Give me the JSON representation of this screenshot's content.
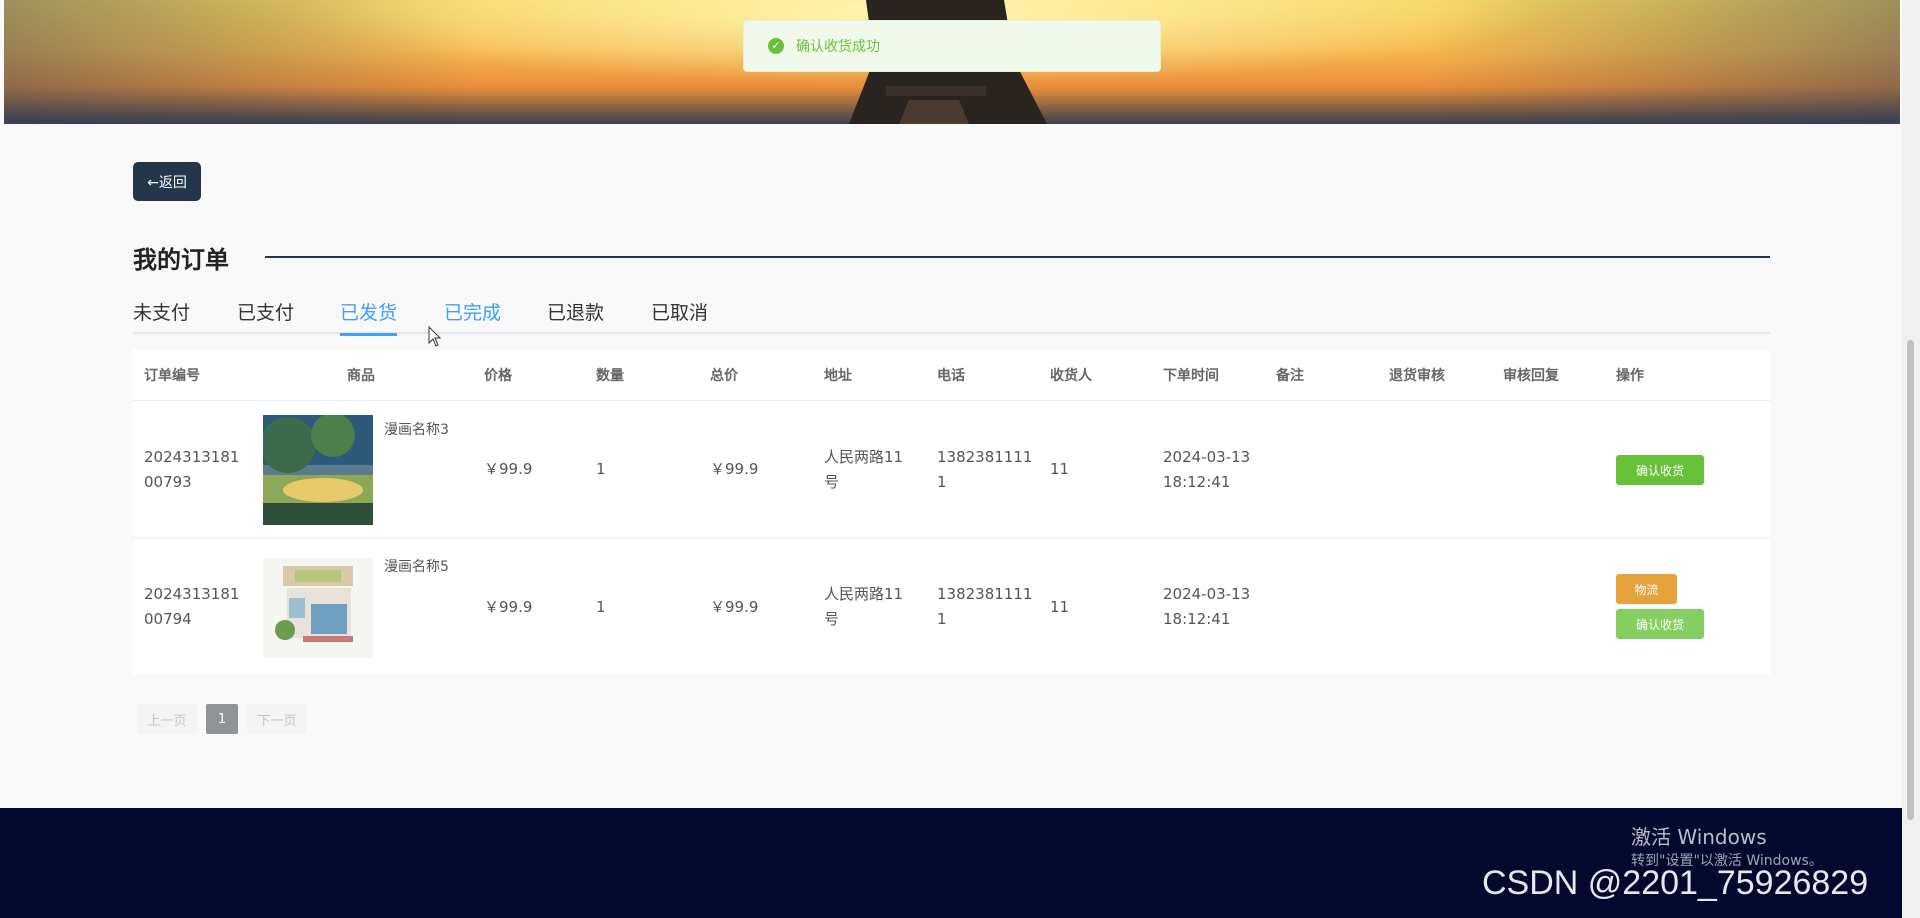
{
  "toast": {
    "icon": "check-circle-icon",
    "message": "确认收货成功"
  },
  "back_button": {
    "label": "←返回"
  },
  "page_title": "我的订单",
  "tabs": [
    {
      "label": "未支付",
      "state": "normal"
    },
    {
      "label": "已支付",
      "state": "normal"
    },
    {
      "label": "已发货",
      "state": "active"
    },
    {
      "label": "已完成",
      "state": "hover"
    },
    {
      "label": "已退款",
      "state": "normal"
    },
    {
      "label": "已取消",
      "state": "normal"
    }
  ],
  "table": {
    "headers": [
      "订单编号",
      "商品",
      "价格",
      "数量",
      "总价",
      "地址",
      "电话",
      "收货人",
      "下单时间",
      "备注",
      "退货审核",
      "审核回复",
      "操作"
    ],
    "rows": [
      {
        "order_no_1": "2024313181",
        "order_no_2": "00793",
        "goods_name": "漫画名称3",
        "price": "￥99.9",
        "qty": "1",
        "total": "￥99.9",
        "address_1": "人民两路11",
        "address_2": "号",
        "phone_1": "1382381111",
        "phone_2": "1",
        "receiver": "11",
        "time_1": "2024-03-13",
        "time_2": "18:12:41",
        "remark": "",
        "return_review": "",
        "review_reply": "",
        "actions": [
          "确认收货"
        ]
      },
      {
        "order_no_1": "2024313181",
        "order_no_2": "00794",
        "goods_name": "漫画名称5",
        "price": "￥99.9",
        "qty": "1",
        "total": "￥99.9",
        "address_1": "人民两路11",
        "address_2": "号",
        "phone_1": "1382381111",
        "phone_2": "1",
        "receiver": "11",
        "time_1": "2024-03-13",
        "time_2": "18:12:41",
        "remark": "",
        "return_review": "",
        "review_reply": "",
        "actions": [
          "物流",
          "确认收货"
        ]
      }
    ]
  },
  "pagination": {
    "prev": "上一页",
    "current": "1",
    "next": "下一页"
  },
  "os_overlay": {
    "activate_title": "激活 Windows",
    "activate_sub": "转到\"设置\"以激活 Windows。"
  },
  "watermark": "CSDN @2201_75926829",
  "colors": {
    "accent_blue": "#409eff",
    "success_green": "#67c23a",
    "warning_orange": "#e6a23c",
    "dark_navy": "#23374b",
    "footer": "#03092e"
  }
}
